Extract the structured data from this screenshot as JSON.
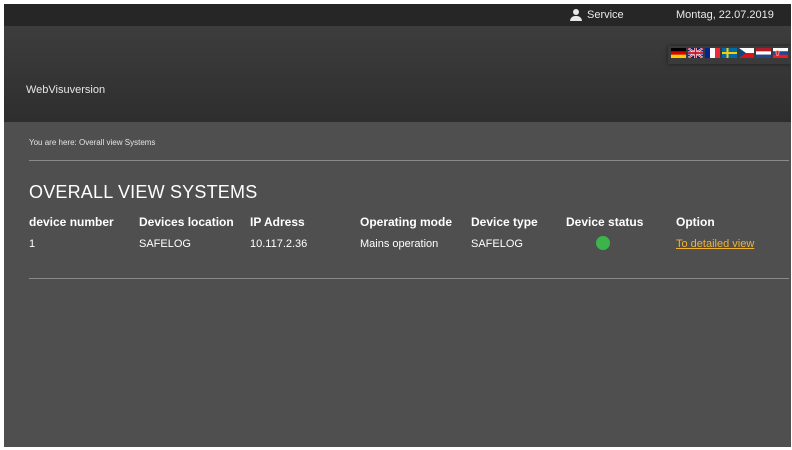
{
  "topbar": {
    "service_label": "Service",
    "service_icon": "user-icon",
    "date": "Montag, 22.07.2019"
  },
  "header": {
    "app_title": "WebVisuversion",
    "languages": [
      {
        "code": "de",
        "icon": "flag-germany-icon"
      },
      {
        "code": "en",
        "icon": "flag-uk-icon"
      },
      {
        "code": "fr",
        "icon": "flag-france-icon"
      },
      {
        "code": "se",
        "icon": "flag-sweden-icon"
      },
      {
        "code": "cz",
        "icon": "flag-czech-icon"
      },
      {
        "code": "nl",
        "icon": "flag-netherlands-icon"
      },
      {
        "code": "sk",
        "icon": "flag-slovakia-icon"
      }
    ]
  },
  "breadcrumb": "You are here: Overall view Systems",
  "page_title": "OVERALL VIEW SYSTEMS",
  "table": {
    "headers": [
      "device number",
      "Devices location",
      "IP Adress",
      "Operating mode",
      "Device type",
      "Device status",
      "Option"
    ],
    "rows": [
      {
        "device_number": "1",
        "location": "SAFELOG",
        "ip": "10.117.2.36",
        "operating_mode": "Mains operation",
        "device_type": "SAFELOG",
        "status": "ok",
        "status_color": "#3bb54a",
        "option_label": "To detailed view"
      }
    ]
  },
  "colors": {
    "background": "#4f4f4f",
    "topbar": "#262626",
    "link": "#f2b233"
  }
}
